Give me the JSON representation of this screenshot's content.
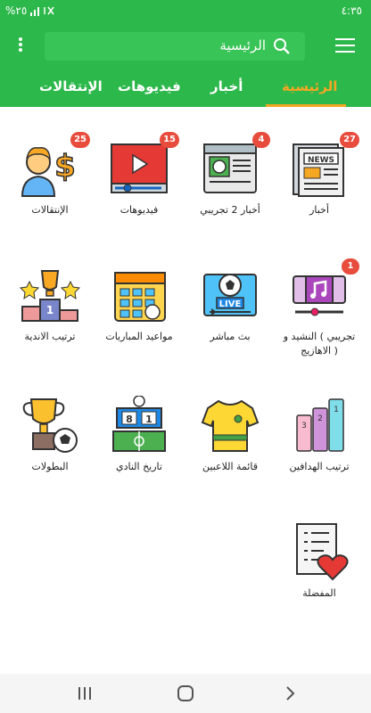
{
  "status_bar": {
    "time": "٤:٣٥",
    "battery": "%٢٥"
  },
  "header": {
    "search_label": "الرئيسية"
  },
  "tabs": [
    {
      "label": "الرئيسية",
      "active": true
    },
    {
      "label": "أخبار",
      "active": false
    },
    {
      "label": "فيديوهات",
      "active": false
    },
    {
      "label": "الإنتقالات",
      "active": false
    }
  ],
  "grid": {
    "news": {
      "label": "أخبار",
      "badge": "27",
      "icon": "newspaper-icon"
    },
    "news2": {
      "label": "أخبار 2 تجريبي",
      "badge": "4",
      "icon": "web-news-icon"
    },
    "videos": {
      "label": "فيديوهات",
      "badge": "15",
      "icon": "video-player-icon"
    },
    "transfers": {
      "label": "الإنتقالات",
      "badge": "25",
      "icon": "player-money-icon"
    },
    "anthem": {
      "label": "تجريبي ) النشيد و الاهازيج )",
      "badge": "1",
      "icon": "music-player-icon"
    },
    "live": {
      "label": "بث مباشر",
      "icon": "live-tv-icon"
    },
    "matches": {
      "label": "مواعيد المباريات",
      "icon": "calendar-icon"
    },
    "standings": {
      "label": "ترتيب الاندية",
      "icon": "podium-icon"
    },
    "scorers": {
      "label": "ترتيب الهدافين",
      "icon": "shirts-ranking-icon"
    },
    "players": {
      "label": "قائمة اللاعبين",
      "icon": "jersey-icon"
    },
    "history": {
      "label": "تاريخ النادي",
      "icon": "scoreboard-icon"
    },
    "trophies": {
      "label": "البطولات",
      "icon": "trophy-icon"
    },
    "favorites": {
      "label": "المفضلة",
      "icon": "favorites-list-icon"
    }
  },
  "colors": {
    "primary": "#2db84b",
    "accent": "#f5a623",
    "badge": "#e74c3c"
  }
}
